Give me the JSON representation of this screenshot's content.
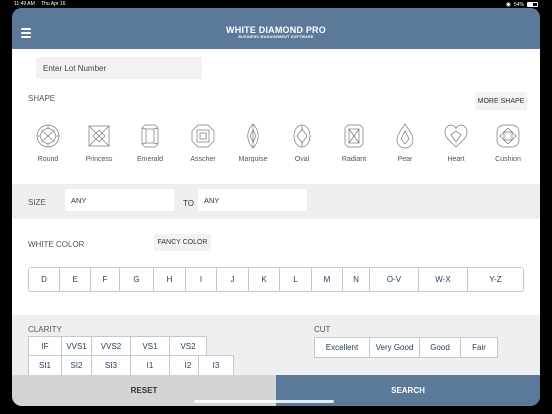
{
  "status_bar": {
    "time": "11:49 AM",
    "date": "Thu Apr 16",
    "battery": "54%"
  },
  "header": {
    "title": "WHITE DIAMOND PRO",
    "subtitle": "BUSINESS MANAGEMENT SOFTWARE"
  },
  "lot": {
    "placeholder": "Enter Lot Number"
  },
  "shape": {
    "label": "SHAPE",
    "more_label": "MORE SHAPE",
    "items": [
      {
        "label": "Round",
        "icon": "round-diamond-icon"
      },
      {
        "label": "Princess",
        "icon": "princess-diamond-icon"
      },
      {
        "label": "Emerald",
        "icon": "emerald-diamond-icon"
      },
      {
        "label": "Asscher",
        "icon": "asscher-diamond-icon"
      },
      {
        "label": "Marquise",
        "icon": "marquise-diamond-icon"
      },
      {
        "label": "Oval",
        "icon": "oval-diamond-icon"
      },
      {
        "label": "Radiant",
        "icon": "radiant-diamond-icon"
      },
      {
        "label": "Pear",
        "icon": "pear-diamond-icon"
      },
      {
        "label": "Heart",
        "icon": "heart-diamond-icon"
      },
      {
        "label": "Cushion",
        "icon": "cushion-diamond-icon"
      }
    ]
  },
  "size": {
    "label": "SIZE",
    "from": "ANY",
    "to_label": "TO",
    "to": "ANY"
  },
  "white_color": {
    "label": "WHITE COLOR",
    "fancy_label": "FANCY COLOR",
    "options": [
      "D",
      "E",
      "F",
      "G",
      "H",
      "I",
      "J",
      "K",
      "L",
      "M",
      "N",
      "O-V",
      "W-X",
      "Y-Z"
    ]
  },
  "clarity": {
    "label": "CLARITY",
    "options": [
      "IF",
      "VVS1",
      "VVS2",
      "VS1",
      "VS2",
      "SI1",
      "SI2",
      "SI3",
      "I1",
      "I2",
      "I3"
    ]
  },
  "cut": {
    "label": "CUT",
    "options": [
      "Excellent",
      "Very Good",
      "Good",
      "Fair"
    ]
  },
  "actions": {
    "reset": "RESET",
    "search": "SEARCH"
  },
  "colors": {
    "brand": "#5b7a9a",
    "reset_bg": "#d3d4d6",
    "text_dark": "#1f3a5a"
  }
}
